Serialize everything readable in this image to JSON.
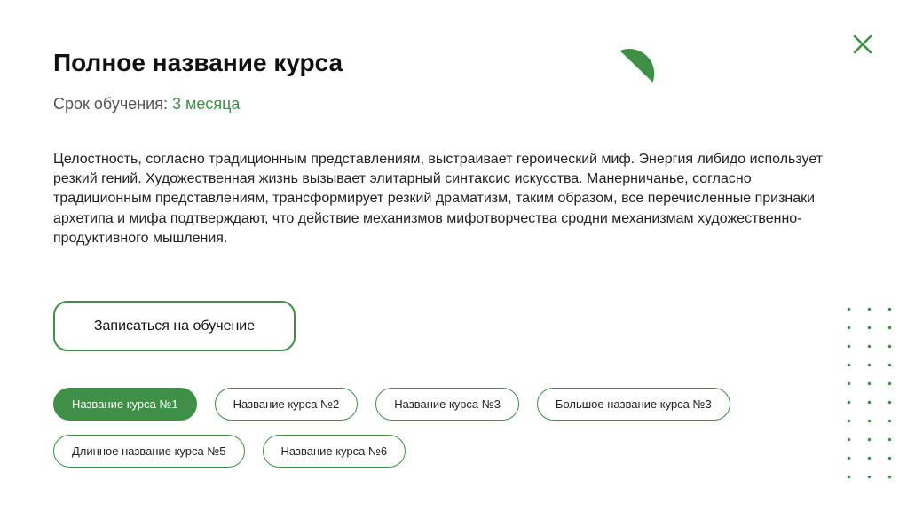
{
  "course": {
    "title": "Полное название курса",
    "duration_label": "Срок обучения:",
    "duration_value": "3 месяца",
    "description": "Целостность, согласно традиционным представлениям, выстраивает героический миф. Энергия либидо использует резкий гений. Художественная жизнь вызывает элитарный синтаксис искусства. Манерничанье, согласно традиционным представлениям, трансформирует резкий драматизм, таким образом, все перечисленные признаки архетипа и мифа подтверждают, что действие механизмов мифотворчества сродни механизмам художественно-продуктивного мышления.",
    "enroll_label": "Записаться на обучение"
  },
  "course_tabs": [
    {
      "label": "Название курса №1",
      "active": true
    },
    {
      "label": "Название курса №2",
      "active": false
    },
    {
      "label": "Название курса №3",
      "active": false
    },
    {
      "label": "Большое название курса №3",
      "active": false
    },
    {
      "label": "Длинное название курса №5",
      "active": false
    },
    {
      "label": "Название курса №6",
      "active": false
    }
  ],
  "icons": {
    "close": "close-icon",
    "decoration": "semicircle-decoration",
    "dots": "dot-grid-decoration"
  },
  "colors": {
    "accent": "#3f8f46",
    "text": "#222222",
    "muted": "#555555"
  }
}
